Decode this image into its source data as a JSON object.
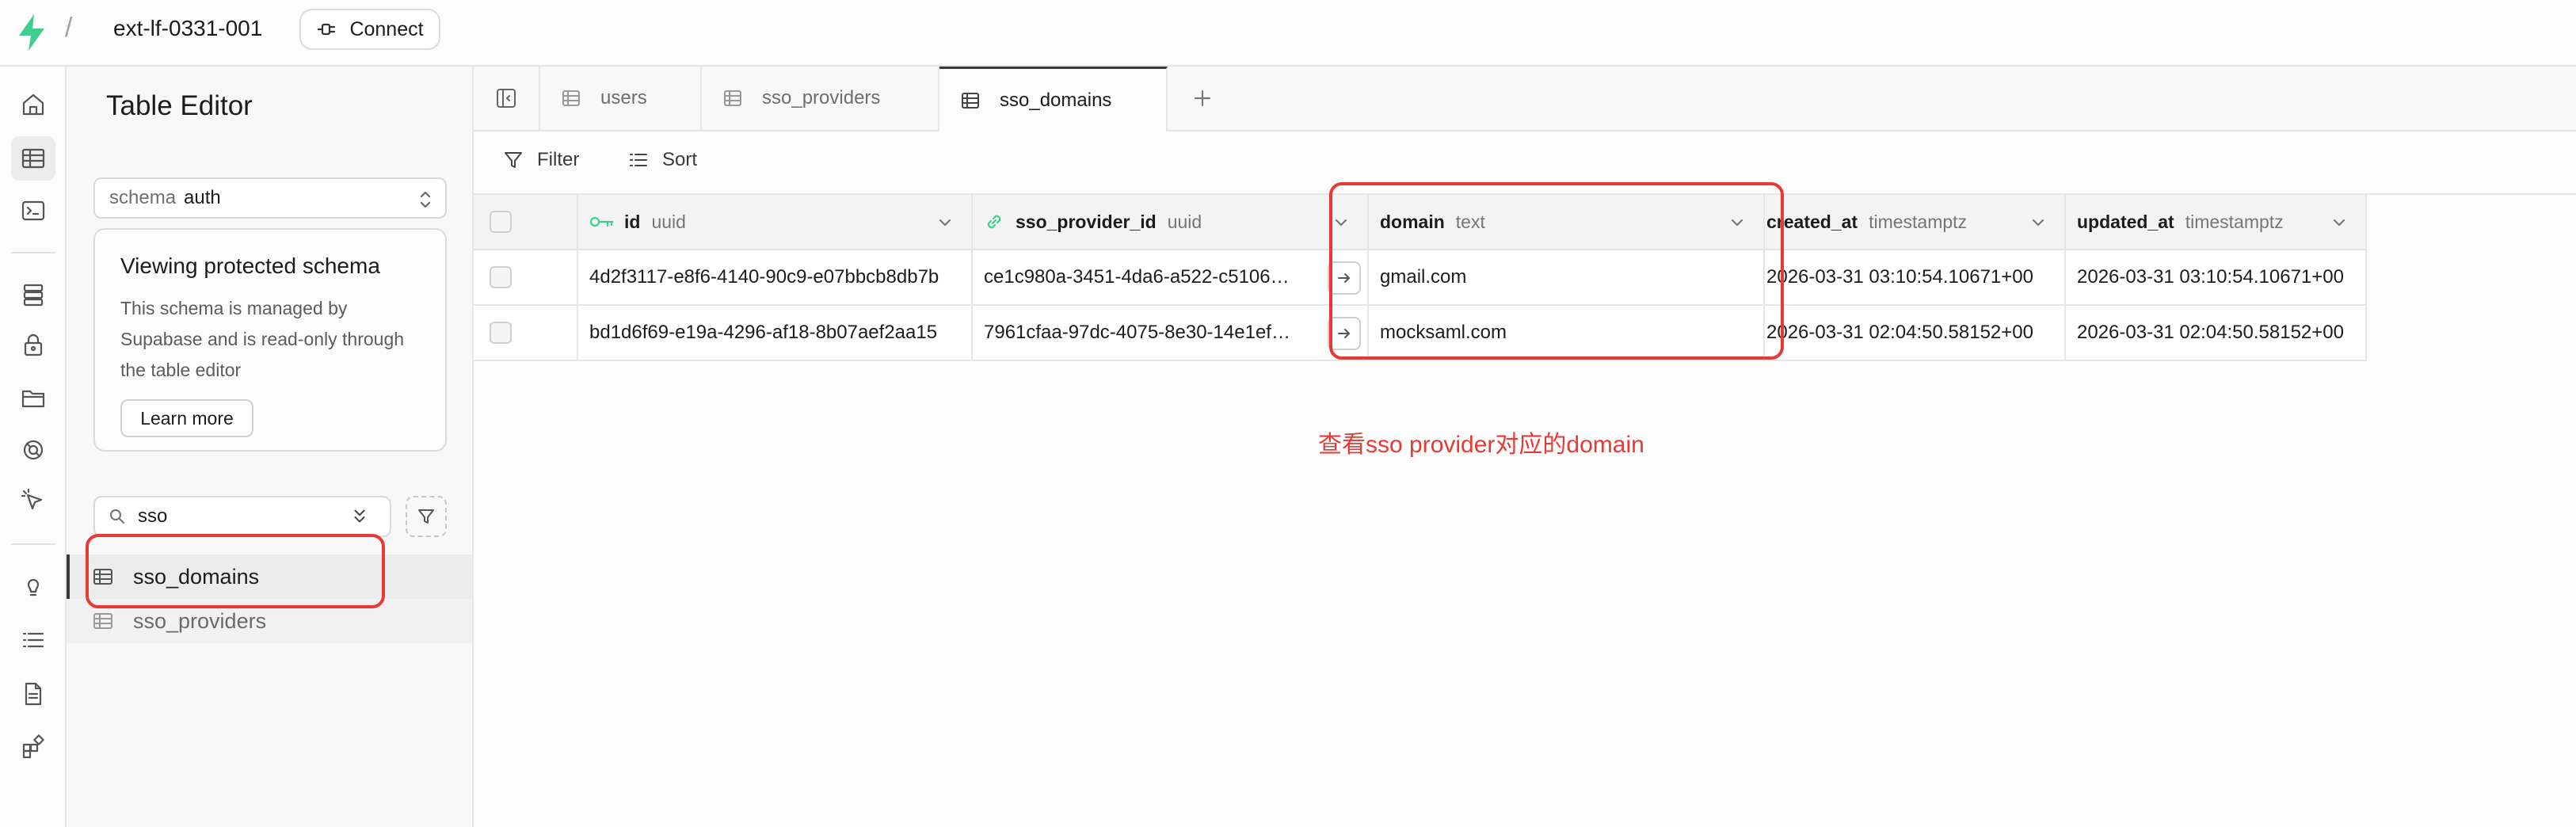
{
  "topbar": {
    "separator": "/",
    "project_name": "ext-lf-0331-001",
    "connect_label": "Connect",
    "brand_color": "#3ecf8e"
  },
  "sidebar": {
    "title": "Table Editor",
    "schema_label": "schema",
    "schema_value": "auth",
    "notice_title": "Viewing protected schema",
    "notice_body": "This schema is managed by Supabase and is read-only through the table editor",
    "learn_more_label": "Learn more",
    "search_value": "sso",
    "tables": [
      "sso_domains",
      "sso_providers"
    ]
  },
  "tabs": [
    "users",
    "sso_providers",
    "sso_domains"
  ],
  "toolbar": {
    "filter_label": "Filter",
    "sort_label": "Sort"
  },
  "grid": {
    "columns": [
      {
        "name": "id",
        "type": "uuid"
      },
      {
        "name": "sso_provider_id",
        "type": "uuid"
      },
      {
        "name": "domain",
        "type": "text"
      },
      {
        "name": "created_at",
        "type": "timestamptz"
      },
      {
        "name": "updated_at",
        "type": "timestamptz"
      }
    ],
    "rows": [
      [
        "4d2f3117-e8f6-4140-90c9-e07bbcb8db7b",
        "ce1c980a-3451-4da6-a522-c5106…",
        "gmail.com",
        "2026-03-31 03:10:54.10671+00",
        "2026-03-31 03:10:54.10671+00"
      ],
      [
        "bd1d6f69-e19a-4296-af18-8b07aef2aa15",
        "7961cfaa-97dc-4075-8e30-14e1ef…",
        "mocksaml.com",
        "2026-03-31 02:04:50.58152+00",
        "2026-03-31 02:04:50.58152+00"
      ]
    ]
  },
  "annotation": {
    "text": "查看sso provider对应的domain",
    "color": "#e53b34"
  }
}
